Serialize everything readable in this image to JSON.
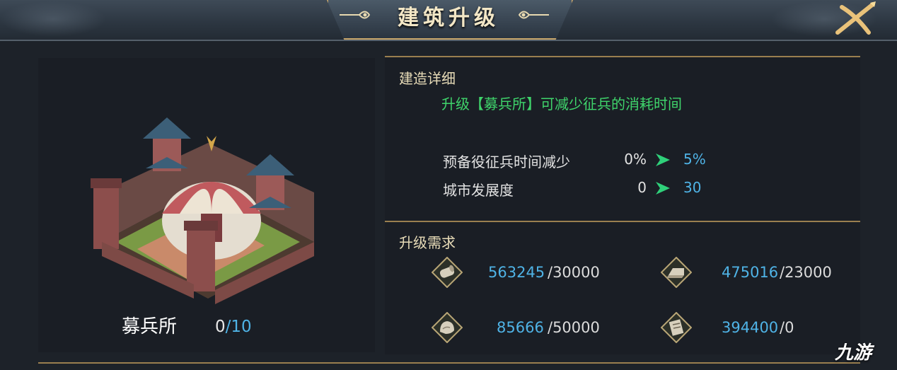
{
  "window": {
    "title": "建筑升级",
    "close_icon": "close-icon"
  },
  "building": {
    "name": "募兵所",
    "level_current": "0",
    "level_separator": "/",
    "level_max": "10",
    "image_icon": "recruitment-camp-building"
  },
  "details": {
    "heading": "建造详细",
    "description": "升级【募兵所】可减少征兵的消耗时间",
    "stats": [
      {
        "label": "预备役征兵时间减少",
        "from": "0%",
        "to": "5%"
      },
      {
        "label": "城市发展度",
        "from": "0",
        "to": "30"
      }
    ]
  },
  "requirements": {
    "heading": "升级需求",
    "resources": [
      {
        "icon": "wood-log-icon",
        "have": "563245",
        "need": "/30000"
      },
      {
        "icon": "iron-ingot-icon",
        "have": "475016",
        "need": "/23000"
      },
      {
        "icon": "stone-icon",
        "have": "85666",
        "need": "/50000"
      },
      {
        "icon": "scroll-icon",
        "have": "394400",
        "need": "/0"
      }
    ]
  },
  "watermark": "九游",
  "colors": {
    "gold_accent": "#c9a66b",
    "green_text": "#3fd46b",
    "blue_value": "#4fb3e6",
    "panel_bg": "#1a1e25",
    "page_bg": "#1d2229"
  }
}
